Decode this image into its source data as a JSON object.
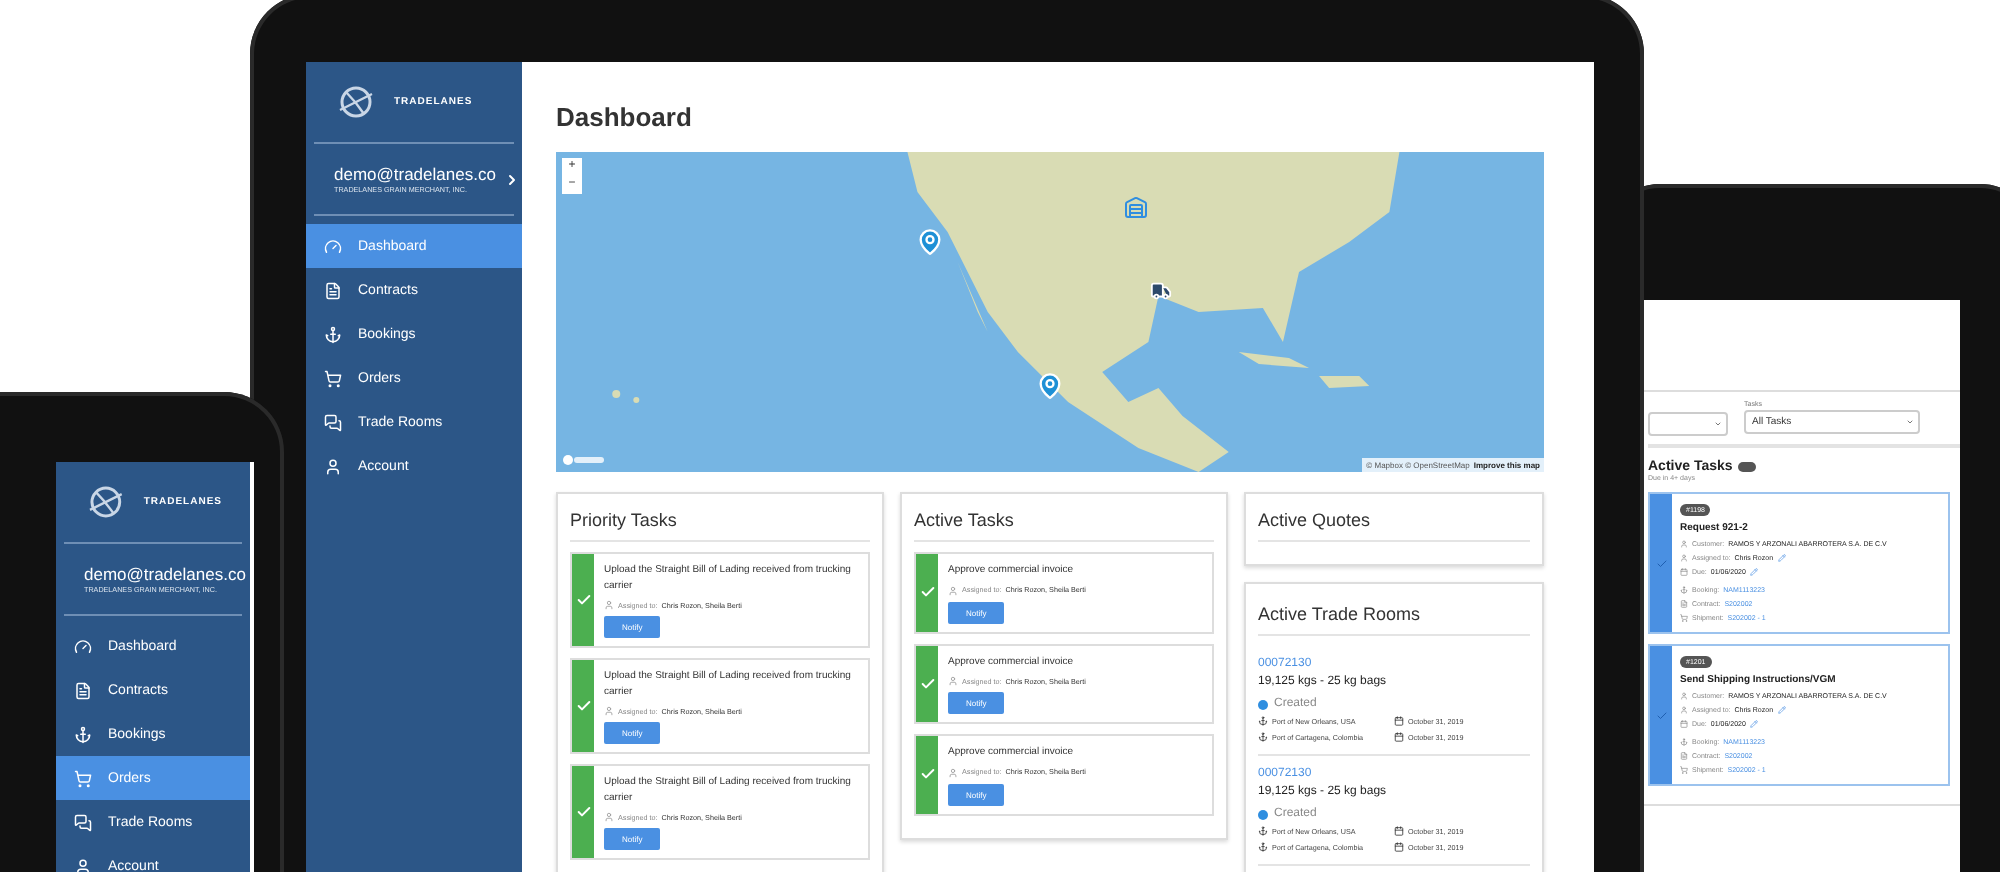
{
  "main_tablet": {
    "brand": "TRADELANES",
    "user": {
      "email": "demo@tradelanes.co",
      "company": "TRADELANES GRAIN MERCHANT, INC."
    },
    "nav": [
      {
        "label": "Dashboard",
        "selected": true
      },
      {
        "label": "Contracts",
        "selected": false
      },
      {
        "label": "Bookings",
        "selected": false
      },
      {
        "label": "Orders",
        "selected": false
      },
      {
        "label": "Trade Rooms",
        "selected": false
      },
      {
        "label": "Account",
        "selected": false
      }
    ],
    "page_title": "Dashboard",
    "map": {
      "zoom_in": "+",
      "zoom_out": "−",
      "attribution": "© Mapbox © OpenStreetMap",
      "attribution_link": "Improve this map"
    },
    "priority_tasks": {
      "title": "Priority Tasks",
      "items": [
        {
          "text": "Upload the Straight Bill of Lading received from trucking carrier",
          "assigned_label": "Assigned to:",
          "assignees": "Chris Rozon, Sheila Berti",
          "button": "Notify",
          "checked": true
        },
        {
          "text": "Upload the Straight Bill of Lading received from trucking carrier",
          "assigned_label": "Assigned to:",
          "assignees": "Chris Rozon, Sheila Berti",
          "button": "Notify",
          "checked": true
        },
        {
          "text": "Upload the Straight Bill of Lading received from trucking carrier",
          "assigned_label": "Assigned to:",
          "assignees": "Chris Rozon, Sheila Berti",
          "button": "Notify",
          "checked": true
        }
      ]
    },
    "active_tasks": {
      "title": "Active Tasks",
      "items": [
        {
          "text": "Approve commercial invoice",
          "assigned_label": "Assigned to:",
          "assignees": "Chris Rozon, Sheila Berti",
          "button": "Notify",
          "checked": true
        },
        {
          "text": "Approve commercial invoice",
          "assigned_label": "Assigned to:",
          "assignees": "Chris Rozon, Sheila Berti",
          "button": "Notify",
          "checked": true
        },
        {
          "text": "Approve commercial invoice",
          "assigned_label": "Assigned to:",
          "assignees": "Chris Rozon, Sheila Berti",
          "button": "Notify",
          "checked": true
        }
      ]
    },
    "active_quotes": {
      "title": "Active Quotes"
    },
    "trade_rooms": {
      "title": "Active Trade Rooms",
      "items": [
        {
          "id": "00072130",
          "quantity": "19,125 kgs - 25 kg bags",
          "status": "Created",
          "color": "#2f8ee0",
          "legs": [
            {
              "port": "Port of New Orleans, USA",
              "date": "October 31, 2019"
            },
            {
              "port": "Port of Cartagena, Colombia",
              "date": "October 31, 2019"
            }
          ]
        },
        {
          "id": "00072130",
          "quantity": "19,125 kgs - 25 kg bags",
          "status": "Created",
          "color": "#2f8ee0",
          "legs": [
            {
              "port": "Port of New Orleans, USA",
              "date": "October 31, 2019"
            },
            {
              "port": "Port of Cartagena, Colombia",
              "date": "October 31, 2019"
            }
          ]
        }
      ]
    }
  },
  "left_tablet": {
    "brand": "TRADELANES",
    "user": {
      "email": "demo@tradelanes.co",
      "company": "TRADELANES GRAIN MERCHANT, INC."
    },
    "nav": [
      {
        "label": "Dashboard",
        "selected": false
      },
      {
        "label": "Contracts",
        "selected": false
      },
      {
        "label": "Bookings",
        "selected": false
      },
      {
        "label": "Orders",
        "selected": true
      },
      {
        "label": "Trade Rooms",
        "selected": false
      },
      {
        "label": "Account",
        "selected": false
      }
    ]
  },
  "right_tablet": {
    "filter_label": "Tasks",
    "filter_value": "All Tasks",
    "section_title": "Active Tasks",
    "section_subtitle": "Due in 4+ days",
    "tasks": [
      {
        "number": "#1198",
        "title": "Request 921-2",
        "customer_label": "Customer:",
        "customer": "RAMOS Y ARZONALI ABARROTERA S.A. DE C.V",
        "assigned_label": "Assigned to:",
        "assignee": "Chris Rozon",
        "due_label": "Due:",
        "due": "01/06/2020",
        "booking_label": "Booking:",
        "booking": "NAM1113223",
        "contract_label": "Contract:",
        "contract": "S202002",
        "shipment_label": "Shipment:",
        "shipment": "S202002 - 1",
        "checked": true
      },
      {
        "number": "#1201",
        "title": "Send Shipping Instructions/VGM",
        "customer_label": "Customer:",
        "customer": "RAMOS Y ARZONALI ABARROTERA S.A. DE C.V",
        "assigned_label": "Assigned to:",
        "assignee": "Chris Rozon",
        "due_label": "Due:",
        "due": "01/06/2020",
        "booking_label": "Booking:",
        "booking": "NAM1113223",
        "contract_label": "Contract:",
        "contract": "S202002",
        "shipment_label": "Shipment:",
        "shipment": "S202002 - 1",
        "checked": true
      }
    ]
  }
}
